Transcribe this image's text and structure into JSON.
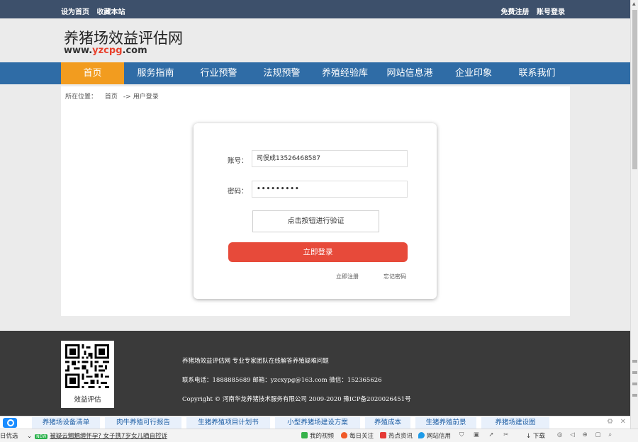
{
  "topbar": {
    "left": [
      "设为首页",
      "收藏本站"
    ],
    "right": [
      "免费注册",
      "账号登录"
    ]
  },
  "header": {
    "title": "养猪场效益评估网",
    "url_prefix": "www.",
    "url_highlight": "yzcpg",
    "url_suffix": ".com"
  },
  "nav": {
    "items": [
      "首页",
      "服务指南",
      "行业预警",
      "法规预警",
      "养殖经验库",
      "网站信息港",
      "企业印象",
      "联系我们"
    ],
    "active_index": 0
  },
  "breadcrumb": {
    "label": "所在位置：",
    "home": "首页",
    "sep": "->",
    "current": "用户登录"
  },
  "login": {
    "account_label": "账号：",
    "account_value": "司俣成13526468587",
    "password_label": "密码：",
    "password_value": "•••••••••",
    "verify_button": "点击按钮进行验证",
    "login_button": "立即登录",
    "register_link": "立即注册",
    "forgot_link": "忘记密码"
  },
  "footer": {
    "qr_label": "效益评估",
    "line1": "养猪场效益评估网 专业专家团队在线解答养殖疑难问题",
    "line2": "联系电话：1888885689 邮箱：yzcxypg@163.com 微信：152365626",
    "line3": "Copyright © 河南华龙养猪技术服务有限公司 2009-2020 豫ICP备2020026451号"
  },
  "tagbar": {
    "tags": [
      "养猪场设备清单",
      "肉牛养殖可行报告",
      "生猪养殖项目计划书",
      "小型养猪场建设方案",
      "养殖成本",
      "生猪养殖前景",
      "养猪场建设图"
    ]
  },
  "statusbar": {
    "left_text": "日优选",
    "badge": "NEW",
    "news": "被疑云魍魉缠怀孕? 女子携7岁女儿晒自控诉",
    "items": [
      "我的视频",
      "每日关注",
      "热点资讯",
      "网站信用",
      "下载"
    ]
  },
  "colors": {
    "topbar": "#3d506b",
    "nav": "#2f6ca6",
    "nav_active": "#f29c1f",
    "login_button": "#e74a3a",
    "footer": "#3a3a3a"
  }
}
